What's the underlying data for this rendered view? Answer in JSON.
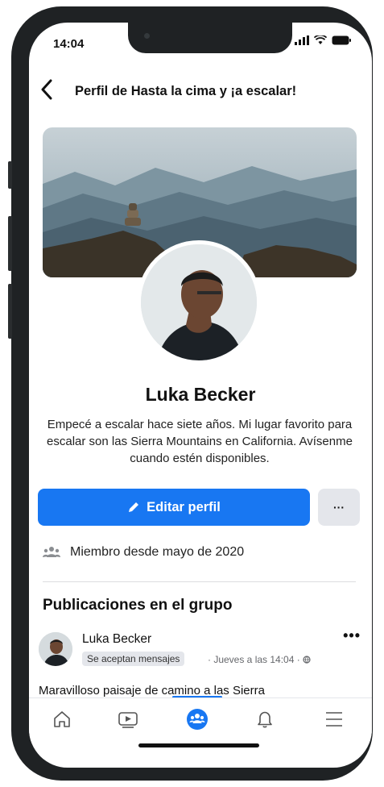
{
  "status_bar": {
    "time": "14:04"
  },
  "header": {
    "title": "Perfil de Hasta la cima y ¡a escalar!"
  },
  "profile": {
    "name": "Luka Becker",
    "bio": "Empecé a escalar hace siete años. Mi lugar favorito para escalar son las Sierra Mountains en California. Avísenme cuando estén disponibles.",
    "edit_label": "Editar perfil",
    "more_label": "···",
    "member_since": "Miembro desde mayo de 2020"
  },
  "posts": {
    "section_title": "Publicaciones en el grupo",
    "items": [
      {
        "author": "Luka Becker",
        "badge": "Se aceptan mensajes",
        "meta": "· Jueves a las 14:04 ·",
        "text": "Maravilloso paisaje de camino a las Sierra",
        "more": "•••"
      }
    ]
  },
  "tabbar": {
    "tabs": [
      "home-icon",
      "video-icon",
      "groups-icon",
      "notifications-icon",
      "menu-icon"
    ],
    "active": "groups-icon"
  },
  "colors": {
    "accent": "#1877f2",
    "badge_bg": "#e4e6eb",
    "muted": "#65676b"
  }
}
